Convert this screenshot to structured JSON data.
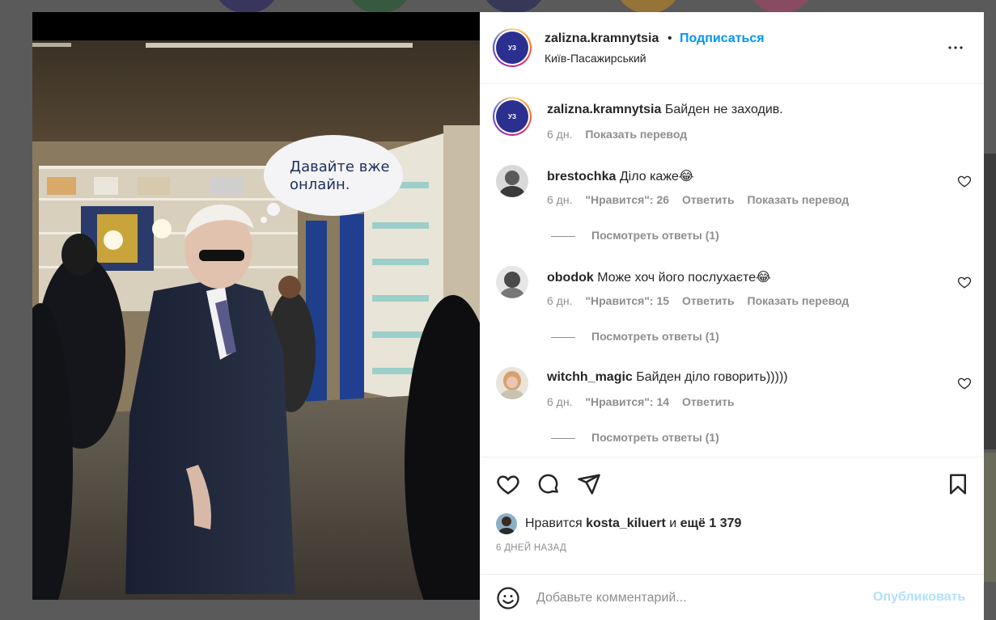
{
  "background": {
    "circle_colors": [
      "#1e1a5e",
      "#1c5a2a",
      "#1a1e56",
      "#c98a1c",
      "#b0406a"
    ]
  },
  "photo": {
    "speech_bubble": "Давайте вже онлайн."
  },
  "header": {
    "username": "zalizna.kramnytsia",
    "separator": "•",
    "follow_label": "Подписаться",
    "location": "Київ-Пасажирський",
    "avatar_text": "УЗ"
  },
  "caption": {
    "username": "zalizna.kramnytsia",
    "text": "Байден не заходив.",
    "time": "6 дн.",
    "translate": "Показать перевод"
  },
  "comments": [
    {
      "username": "brestochka",
      "text": "Діло каже😂",
      "time": "6 дн.",
      "likes": "\"Нравится\": 26",
      "reply": "Ответить",
      "translate": "Показать перевод",
      "view_replies": "Посмотреть ответы (1)"
    },
    {
      "username": "obodok",
      "text": "Може хоч його послухаєте😂",
      "time": "6 дн.",
      "likes": "\"Нравится\": 15",
      "reply": "Ответить",
      "translate": "Показать перевод",
      "view_replies": "Посмотреть ответы (1)"
    },
    {
      "username": "witchh_magic",
      "text": "Байден діло говорить)))))",
      "time": "6 дн.",
      "likes": "\"Нравится\": 14",
      "reply": "Ответить",
      "translate": "",
      "view_replies": "Посмотреть ответы (1)"
    }
  ],
  "likes_summary": {
    "prefix": "Нравится",
    "user": "kosta_kiluert",
    "conj": "и",
    "rest": "ещё 1 379"
  },
  "post_date": "6 ДНЕЙ НАЗАД",
  "comment_box": {
    "placeholder": "Добавьте комментарий...",
    "publish_label": "Опубликовать"
  },
  "icons": {
    "more": "more-horizontal-icon",
    "like": "heart-icon",
    "comment": "comment-icon",
    "share": "send-icon",
    "save": "bookmark-icon",
    "emoji": "emoji-icon"
  }
}
